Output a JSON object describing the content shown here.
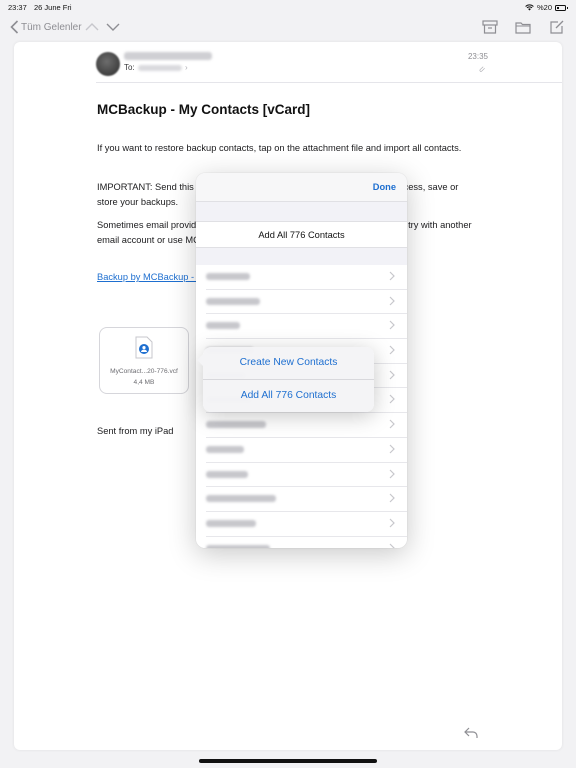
{
  "status_bar": {
    "time": "23:37",
    "date": "26 June Fri",
    "battery": "%20"
  },
  "nav": {
    "back_label": "Tüm Gelenler"
  },
  "mail": {
    "to_label": "To:",
    "time": "23:35",
    "subject": "MCBackup - My Contacts [vCard]",
    "paragraph1": "If you want to restore backup contacts, tap on the attachment file and import all contacts.",
    "paragraph2": "IMPORTANT: Send this email to yourself. After that, you can have quick access, save or store your backups.",
    "paragraph3": "Sometimes email providers may block large attachments or charge. Please try with another email account or use MCBackup app feature for Wi-Fi Download feature.",
    "link": "Backup by MCBackup - My Contacts Backup",
    "signature": "Sent from my iPad",
    "attachment": {
      "name": "MyContact...20-776.vcf",
      "size": "4,4 MB"
    }
  },
  "sheet": {
    "done_label": "Done",
    "add_all_label": "Add All 776 Contacts",
    "contacts": [
      "Can Albat",
      "Sim Coplun",
      "Okyat El",
      "Mehmet Ak",
      "Orhan Tay",
      "Ali Demir",
      "Erdogan Bayrak",
      "Saban Can",
      "Ergi Karacan",
      "Mehmet Ulku Grey",
      "Enes Selman",
      "Zeynep Kaya"
    ]
  },
  "popover": {
    "item1": "Create New Contacts",
    "item2": "Add All 776 Contacts"
  },
  "colors": {
    "accent": "#1e6fd0",
    "background": "#f2f2f4"
  }
}
